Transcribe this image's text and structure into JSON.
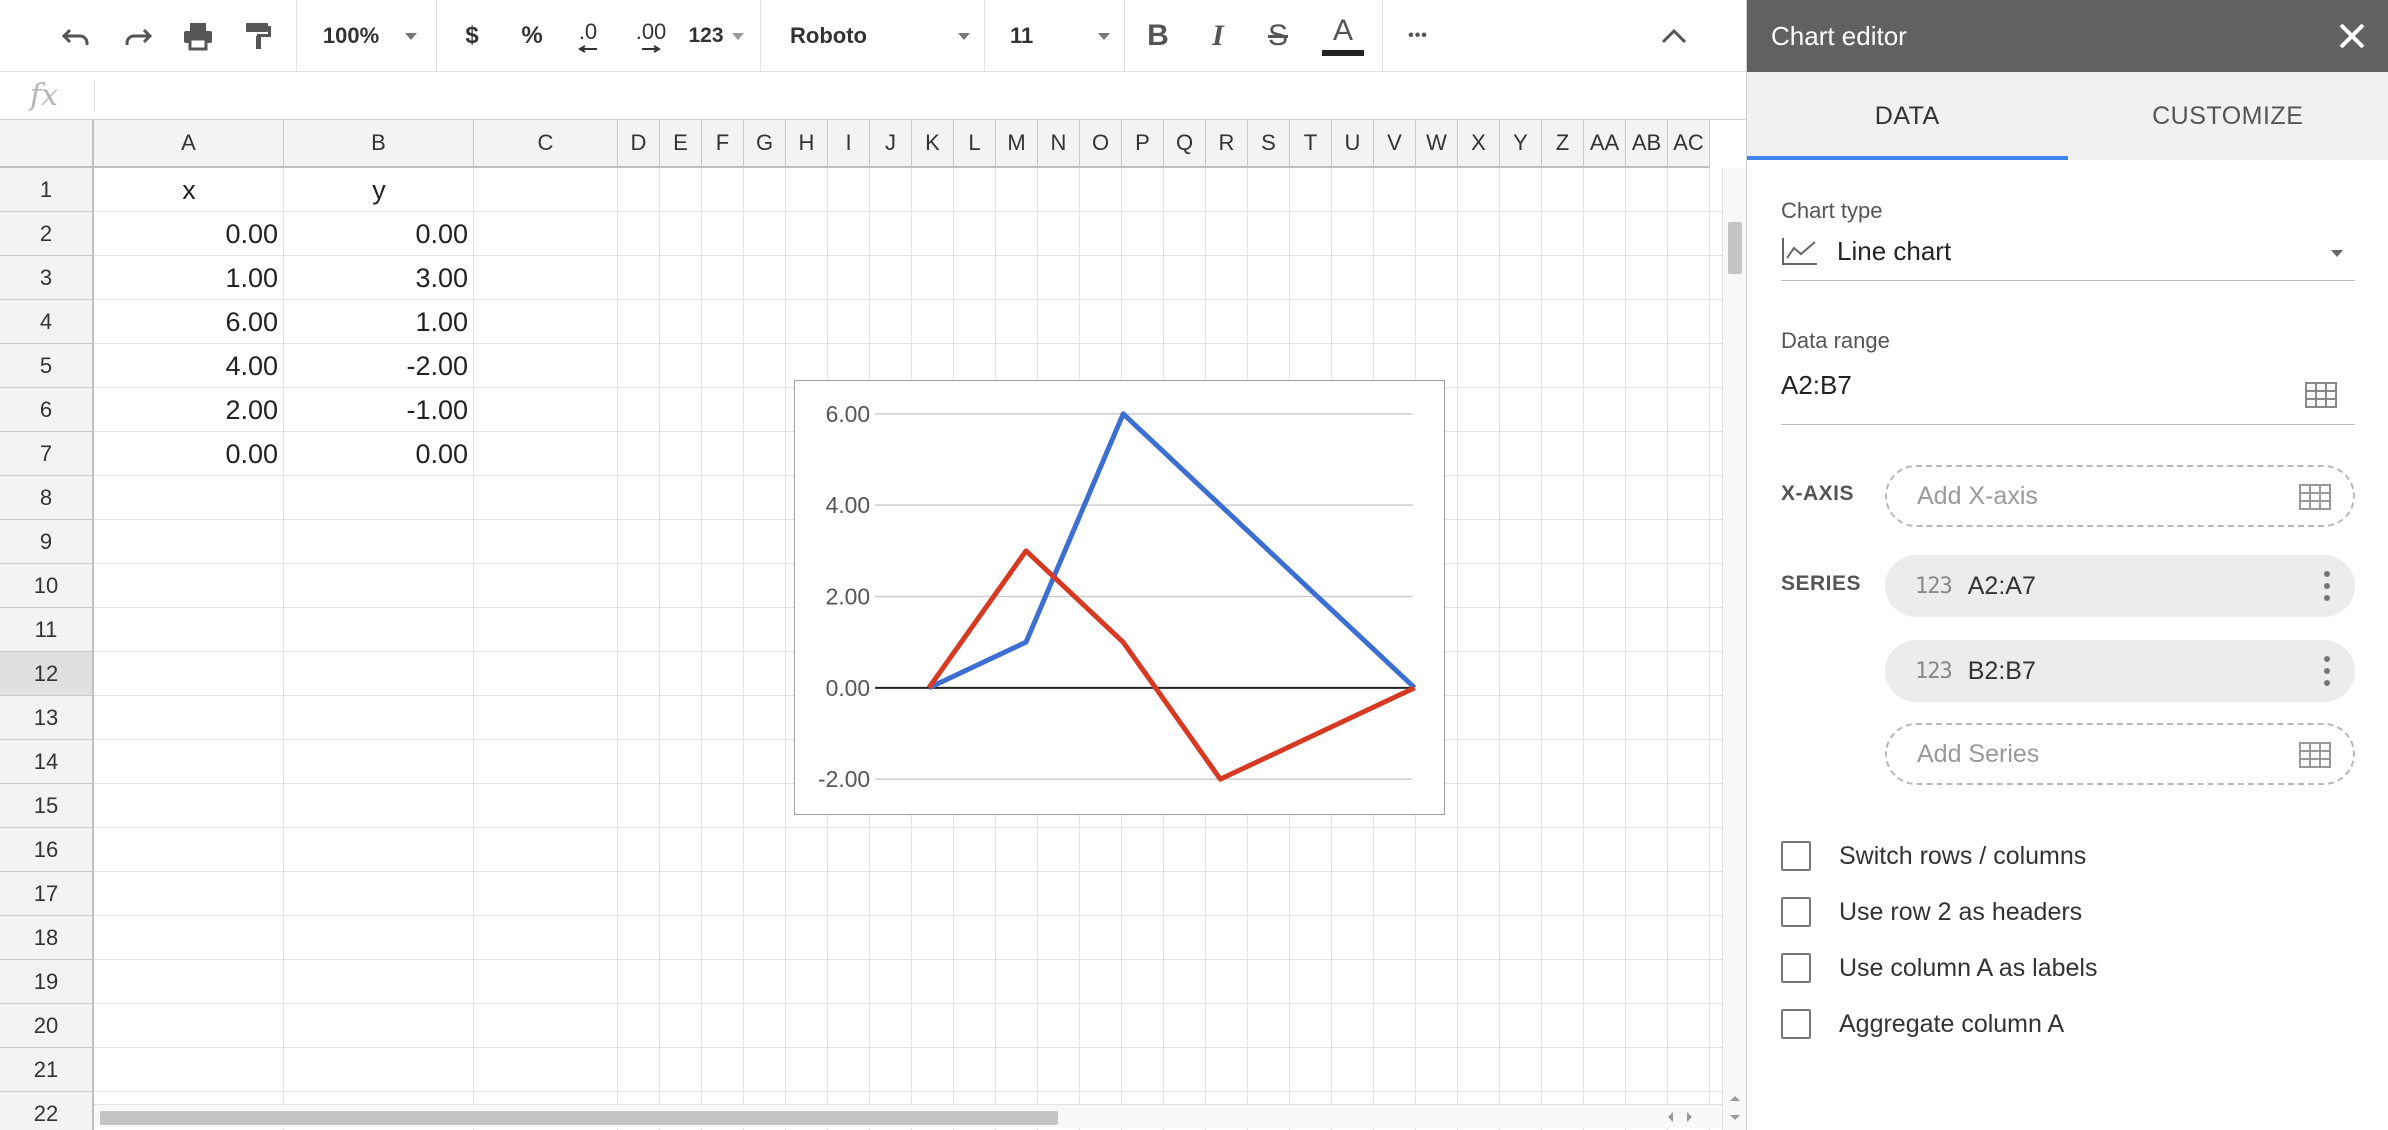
{
  "toolbar": {
    "zoom": "100%",
    "currency": "$",
    "percent": "%",
    "decrease_decimals": ".0",
    "increase_decimals": ".00",
    "more_formats": "123",
    "font": "Roboto",
    "font_size": "11",
    "bold": "B",
    "italic": "I",
    "strikethrough": "S",
    "text_color": "A",
    "more": "•••"
  },
  "formula_bar": {
    "fx": "fx"
  },
  "grid": {
    "columns": [
      "A",
      "B",
      "C",
      "D",
      "E",
      "F",
      "G",
      "H",
      "I",
      "J",
      "K",
      "L",
      "M",
      "N",
      "O",
      "P",
      "Q",
      "R",
      "S",
      "T",
      "U",
      "V",
      "W",
      "X",
      "Y",
      "Z",
      "AA",
      "AB",
      "AC"
    ],
    "rows": [
      "1",
      "2",
      "3",
      "4",
      "5",
      "6",
      "7",
      "8",
      "9",
      "10",
      "11",
      "12",
      "13",
      "14",
      "15",
      "16",
      "17",
      "18",
      "19",
      "20",
      "21",
      "22"
    ],
    "selected_row": "12",
    "cells": [
      [
        "x",
        "y"
      ],
      [
        "0.00",
        "0.00"
      ],
      [
        "1.00",
        "3.00"
      ],
      [
        "6.00",
        "1.00"
      ],
      [
        "4.00",
        "-2.00"
      ],
      [
        "2.00",
        "-1.00"
      ],
      [
        "0.00",
        "0.00"
      ]
    ]
  },
  "chart_data": {
    "type": "line",
    "ylim": [
      -2,
      6
    ],
    "y_ticks": [
      "6.00",
      "4.00",
      "2.00",
      "0.00",
      "-2.00"
    ],
    "tick_values": [
      6,
      4,
      2,
      0,
      -2
    ],
    "x": [
      0,
      1,
      2,
      3,
      4,
      5
    ],
    "series": [
      {
        "color": "#3c6fd1",
        "values": [
          0,
          1,
          6,
          4,
          2,
          0
        ]
      },
      {
        "color": "#d63a22",
        "values": [
          0,
          3,
          1,
          -2,
          -1,
          0
        ]
      }
    ],
    "gridlines": true
  },
  "editor": {
    "title": "Chart editor",
    "tabs": [
      "DATA",
      "CUSTOMIZE"
    ],
    "chart_type_label": "Chart type",
    "chart_type_value": "Line chart",
    "data_range_label": "Data range",
    "data_range_value": "A2:B7",
    "xaxis_label": "X-AXIS",
    "xaxis_placeholder": "Add X-axis",
    "series_label": "SERIES",
    "series": [
      "A2:A7",
      "B2:B7"
    ],
    "series_type_glyph": "123",
    "add_series": "Add Series",
    "options": [
      "Switch rows / columns",
      "Use row 2 as headers",
      "Use column A as labels",
      "Aggregate column A"
    ]
  }
}
